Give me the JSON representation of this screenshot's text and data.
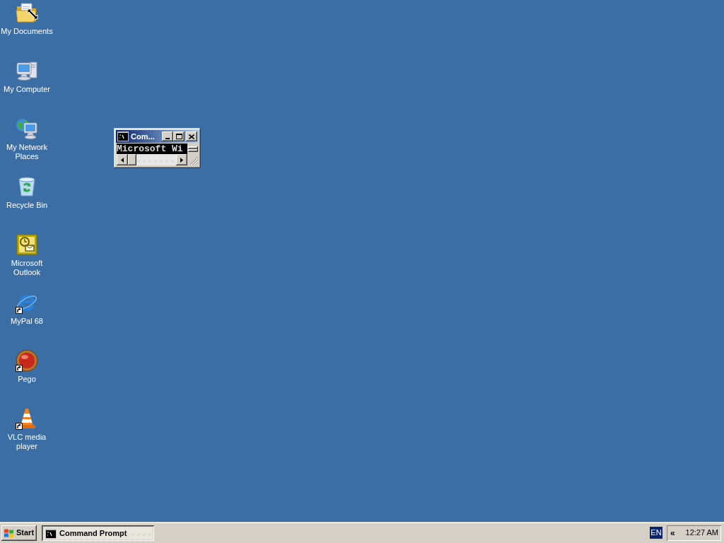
{
  "desktop": {
    "icons": [
      {
        "kind": "documents",
        "label": "My Documents",
        "shortcut": false
      },
      {
        "kind": "computer",
        "label": "My Computer",
        "shortcut": false
      },
      {
        "kind": "network",
        "label": "My Network Places",
        "shortcut": false
      },
      {
        "kind": "recycle_bin",
        "label": "Recycle Bin",
        "shortcut": false
      },
      {
        "kind": "outlook",
        "label": "Microsoft Outlook",
        "shortcut": false
      },
      {
        "kind": "browser",
        "label": "MyPal 68",
        "shortcut": true
      },
      {
        "kind": "pego",
        "label": "Pego",
        "shortcut": true
      },
      {
        "kind": "vlc",
        "label": "VLC media player",
        "shortcut": true
      }
    ]
  },
  "window": {
    "title": "Com...",
    "active": true,
    "console_text": "Microsoft Wi"
  },
  "taskbar": {
    "start_label": "Start",
    "tasks": [
      {
        "label": "Command Prompt",
        "selected": true
      }
    ],
    "language": "EN",
    "tray_toggle": "«",
    "clock": "12:27 AM"
  }
}
